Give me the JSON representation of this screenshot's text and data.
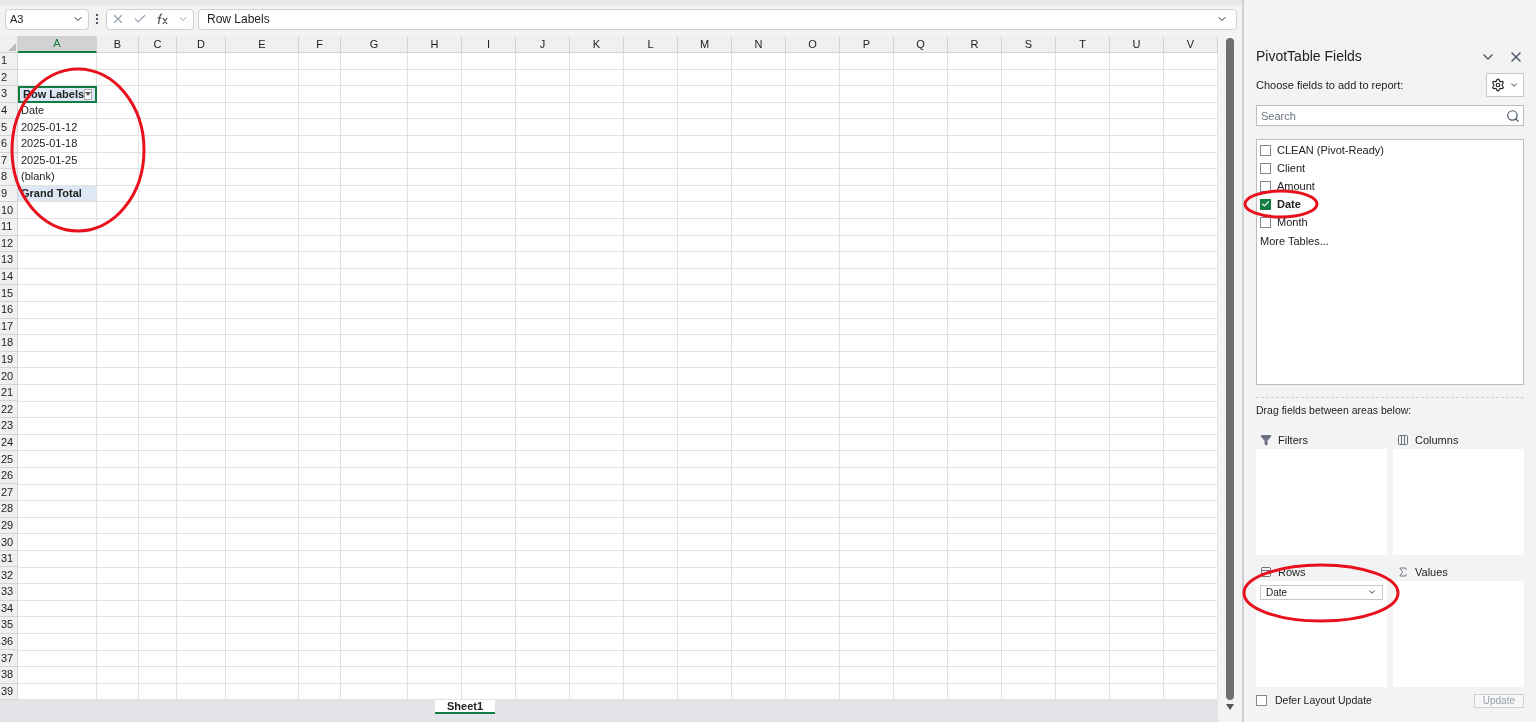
{
  "formula_bar": {
    "name_box": "A3",
    "formula": "Row Labels"
  },
  "sheet": {
    "columns": [
      {
        "label": "A",
        "selected": true
      },
      {
        "label": "B",
        "selected": false
      },
      {
        "label": "C",
        "selected": false
      },
      {
        "label": "D",
        "selected": false
      },
      {
        "label": "E",
        "selected": false
      },
      {
        "label": "F",
        "selected": false
      },
      {
        "label": "G",
        "selected": false
      },
      {
        "label": "H",
        "selected": false
      },
      {
        "label": "I",
        "selected": false
      },
      {
        "label": "J",
        "selected": false
      },
      {
        "label": "K",
        "selected": false
      },
      {
        "label": "L",
        "selected": false
      },
      {
        "label": "M",
        "selected": false
      },
      {
        "label": "N",
        "selected": false
      },
      {
        "label": "O",
        "selected": false
      },
      {
        "label": "P",
        "selected": false
      },
      {
        "label": "Q",
        "selected": false
      },
      {
        "label": "R",
        "selected": false
      },
      {
        "label": "S",
        "selected": false
      },
      {
        "label": "T",
        "selected": false
      },
      {
        "label": "U",
        "selected": false
      },
      {
        "label": "V",
        "selected": false
      }
    ],
    "rows": [
      {
        "label": "1"
      },
      {
        "label": "2"
      },
      {
        "label": "3",
        "cell": {
          "kind": "header",
          "text": "Row Labels",
          "selected": true
        }
      },
      {
        "label": "4",
        "cell": {
          "kind": "item",
          "text": "Date",
          "selected": false
        }
      },
      {
        "label": "5",
        "cell": {
          "kind": "item",
          "text": "2025-01-12",
          "selected": false
        }
      },
      {
        "label": "6",
        "cell": {
          "kind": "item",
          "text": "2025-01-18",
          "selected": false
        }
      },
      {
        "label": "7",
        "cell": {
          "kind": "item",
          "text": "2025-01-25",
          "selected": false
        }
      },
      {
        "label": "8",
        "cell": {
          "kind": "item",
          "text": "(blank)",
          "selected": false
        }
      },
      {
        "label": "9",
        "cell": {
          "kind": "total",
          "text": "Grand Total",
          "selected": false
        }
      },
      {
        "label": "10"
      },
      {
        "label": "11"
      },
      {
        "label": "12"
      },
      {
        "label": "13"
      },
      {
        "label": "14"
      },
      {
        "label": "15"
      },
      {
        "label": "16"
      },
      {
        "label": "17"
      },
      {
        "label": "18"
      },
      {
        "label": "19"
      },
      {
        "label": "20"
      },
      {
        "label": "21"
      },
      {
        "label": "22"
      },
      {
        "label": "23"
      },
      {
        "label": "24"
      },
      {
        "label": "25"
      },
      {
        "label": "26"
      },
      {
        "label": "27"
      },
      {
        "label": "28"
      },
      {
        "label": "29"
      },
      {
        "label": "30"
      },
      {
        "label": "31"
      },
      {
        "label": "32"
      },
      {
        "label": "33"
      },
      {
        "label": "34"
      },
      {
        "label": "35"
      },
      {
        "label": "36"
      },
      {
        "label": "37"
      },
      {
        "label": "38"
      },
      {
        "label": "39"
      }
    ],
    "tab": "Sheet1"
  },
  "pane": {
    "title": "PivotTable Fields",
    "subtitle": "Choose fields to add to report:",
    "search": {
      "placeholder": "Search"
    },
    "fields": [
      {
        "label": "CLEAN (Pivot-Ready)",
        "checked": false
      },
      {
        "label": "Client",
        "checked": false
      },
      {
        "label": "Amount",
        "checked": false
      },
      {
        "label": "Date",
        "checked": true
      },
      {
        "label": "Month",
        "checked": false
      }
    ],
    "more_tables": "More Tables...",
    "drag_hint": "Drag fields between areas below:",
    "areas": [
      {
        "kind": "filters",
        "label": "Filters"
      },
      {
        "kind": "columns",
        "label": "Columns"
      },
      {
        "kind": "rows",
        "label": "Rows",
        "items": [
          "Date"
        ]
      },
      {
        "kind": "values",
        "label": "Values"
      }
    ],
    "defer": {
      "label": "Defer Layout Update",
      "checked": false
    },
    "update": "Update"
  }
}
